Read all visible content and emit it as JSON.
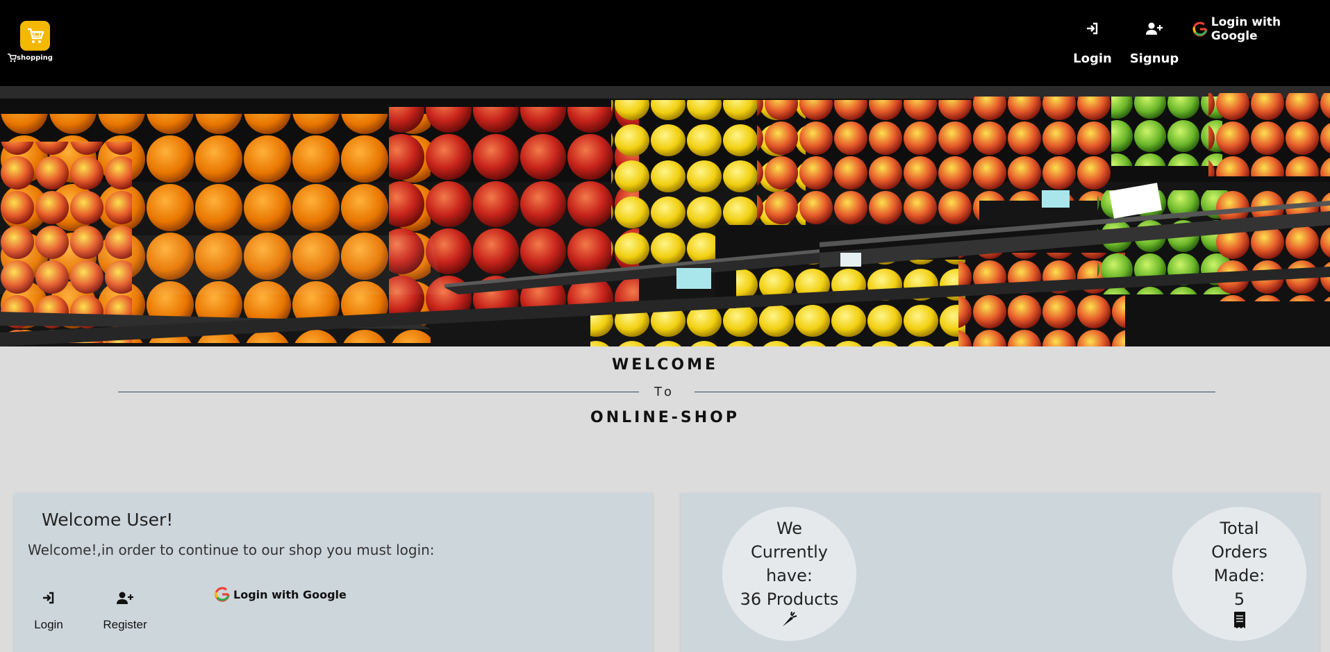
{
  "header": {
    "logo_text": "shopping",
    "nav": {
      "login_label": "Login",
      "signup_label": "Signup",
      "google_label": "Login with Google"
    }
  },
  "hero": {
    "image": "supermarket-fruit-shelves"
  },
  "welcome": {
    "title": "WELCOME",
    "to": "To",
    "shop": "ONLINE-SHOP"
  },
  "user_card": {
    "title": "Welcome User!",
    "message": "Welcome!,in order to continue to our shop you must login:",
    "login_label": "Login",
    "register_label": "Register",
    "google_label": "Login with Google"
  },
  "stats": {
    "products_line1": "We",
    "products_line2": "Currently",
    "products_line3": "have:",
    "products_line4": "36 Products",
    "orders_line1": "Total",
    "orders_line2": "Orders",
    "orders_line3": "Made:",
    "orders_count": "5"
  },
  "colors": {
    "topbar": "#000000",
    "logo_badge": "#f5b800",
    "card_bg": "#cdd6db",
    "page_bg": "#dcdcdc",
    "divider": "#2e4a66"
  }
}
